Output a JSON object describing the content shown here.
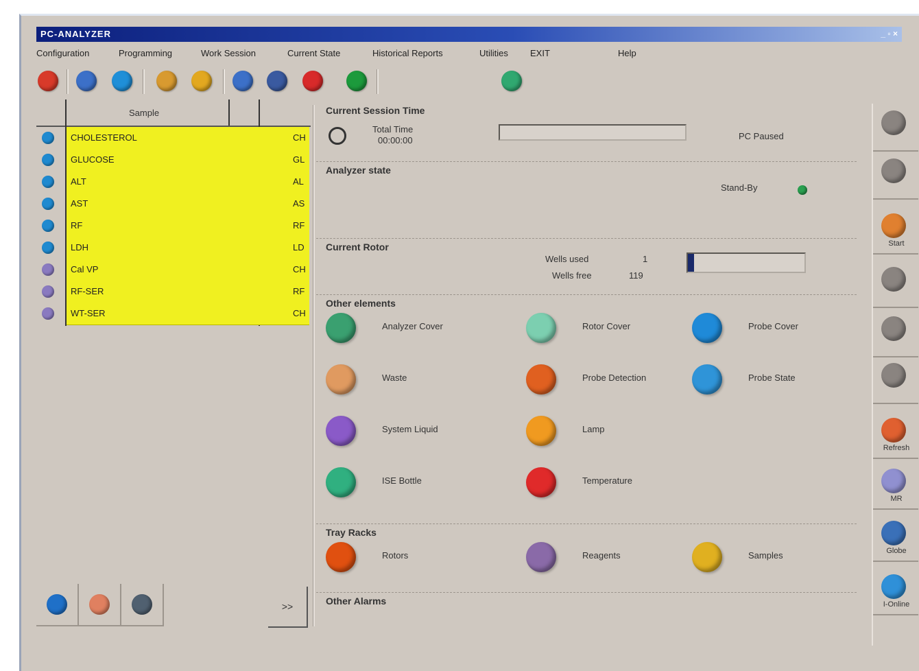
{
  "window": {
    "title": "PC-ANALYZER",
    "controls": "_ ▫ ×"
  },
  "menu": [
    "Configuration",
    "Programming",
    "Work Session",
    "Current State",
    "Historical Reports",
    "Utilities",
    "EXIT",
    "Help"
  ],
  "toolbar": {
    "icons": [
      {
        "name": "home-icon",
        "color": "#d83a2a"
      },
      {
        "name": "gear-icon",
        "color": "#3c70c8"
      },
      {
        "name": "info-icon",
        "color": "#1f8fd8"
      },
      {
        "name": "coin-icon",
        "color": "#d89a30"
      },
      {
        "name": "sun-icon",
        "color": "#e2a820"
      },
      {
        "name": "settings-icon",
        "color": "#3c70c8"
      },
      {
        "name": "monitor-icon",
        "color": "#3a5aa0"
      },
      {
        "name": "stop-icon",
        "color": "#d82a2a"
      },
      {
        "name": "phone-icon",
        "color": "#1c9a3c"
      },
      {
        "name": "chart-icon",
        "color": "#30a870"
      }
    ]
  },
  "samples": {
    "header": "Sample",
    "rows": [
      {
        "name": "CHOLESTEROL",
        "code": "CH",
        "color": "#1f8ad0"
      },
      {
        "name": "GLUCOSE",
        "code": "GL",
        "color": "#1f8ad0"
      },
      {
        "name": "ALT",
        "code": "AL",
        "color": "#1f8ad0"
      },
      {
        "name": "AST",
        "code": "AS",
        "color": "#1f8ad0"
      },
      {
        "name": "RF",
        "code": "RF",
        "color": "#1f8ad0"
      },
      {
        "name": "LDH",
        "code": "LD",
        "color": "#1f8ad0"
      },
      {
        "name": "Cal VP",
        "code": "CH",
        "color": "#8a7ac0"
      },
      {
        "name": "RF-SER",
        "code": "RF",
        "color": "#8a7ac0"
      },
      {
        "name": "WT-SER",
        "code": "CH",
        "color": "#8a7ac0"
      }
    ]
  },
  "session": {
    "heading": "Current Session Time",
    "total_label": "Total Time",
    "total_value": "00:00:00",
    "progress_fraction": 0,
    "status": "PC Paused"
  },
  "analyzer": {
    "heading": "Analyzer state",
    "state_label": "Stand-By"
  },
  "rotor": {
    "heading": "Current Rotor",
    "wells_used_label": "Wells used",
    "wells_used": "1",
    "wells_free_label": "Wells free",
    "wells_free": "119",
    "fill_fraction": 0.05
  },
  "other": {
    "heading": "Other elements",
    "items": [
      {
        "label": "Analyzer Cover",
        "icon": "cover-icon",
        "color": "#3aa070"
      },
      {
        "label": "Rotor Cover",
        "icon": "rotor-cover-icon",
        "color": "#7ccfb0"
      },
      {
        "label": "Probe Cover",
        "icon": "probe-cover-icon",
        "color": "#1f8ad8"
      },
      {
        "label": "Waste",
        "icon": "waste-icon",
        "color": "#e09a60"
      },
      {
        "label": "Probe Detection",
        "icon": "detection-icon",
        "color": "#e06020"
      },
      {
        "label": "Probe State",
        "icon": "probe-state-icon",
        "color": "#2f94d8"
      },
      {
        "label": "System Liquid",
        "icon": "liquid-icon",
        "color": "#8a5ac8"
      },
      {
        "label": "Lamp",
        "icon": "lamp-icon",
        "color": "#f09a20"
      },
      {
        "label": "ISE Bottle",
        "icon": "bottle-icon",
        "color": "#30b080"
      },
      {
        "label": "Temperature",
        "icon": "thermometer-icon",
        "color": "#e02a2a"
      }
    ]
  },
  "trays": {
    "heading": "Tray Racks",
    "items": [
      {
        "label": "Rotors",
        "icon": "rotor-tray-icon",
        "color": "#e05010"
      },
      {
        "label": "Reagents",
        "icon": "reagents-icon",
        "color": "#8a6aa8"
      },
      {
        "label": "Samples",
        "icon": "samples-icon",
        "color": "#e0b020"
      }
    ]
  },
  "alarms": {
    "heading": "Other Alarms"
  },
  "sidebar": {
    "items": [
      {
        "label": "",
        "icon": "hex-icon",
        "color": "#8a8480"
      },
      {
        "label": "",
        "icon": "hex2-icon",
        "color": "#8a8480"
      },
      {
        "label": "Start",
        "icon": "start-icon",
        "color": "#e08030"
      },
      {
        "label": "",
        "icon": "pause-icon",
        "color": "#8a8480"
      },
      {
        "label": "",
        "icon": "stop-side-icon",
        "color": "#8a8480"
      },
      {
        "label": "",
        "icon": "refresh-icon",
        "color": "#8a8480"
      },
      {
        "label": "Refresh",
        "icon": "refresh-start-icon",
        "color": "#e06030"
      },
      {
        "label": "MR",
        "icon": "mr-icon",
        "color": "#9090d0"
      },
      {
        "label": "Globe",
        "icon": "globe-icon",
        "color": "#3a70b8"
      },
      {
        "label": "I-Online",
        "icon": "online-icon",
        "color": "#2f90d8"
      }
    ]
  },
  "bottom": {
    "buttons": [
      {
        "icon": "info-circle-icon",
        "color": "#1f70c8"
      },
      {
        "icon": "user-icon",
        "color": "#e08060"
      },
      {
        "icon": "tools-icon",
        "color": "#506070"
      }
    ],
    "more_label": ">>"
  }
}
